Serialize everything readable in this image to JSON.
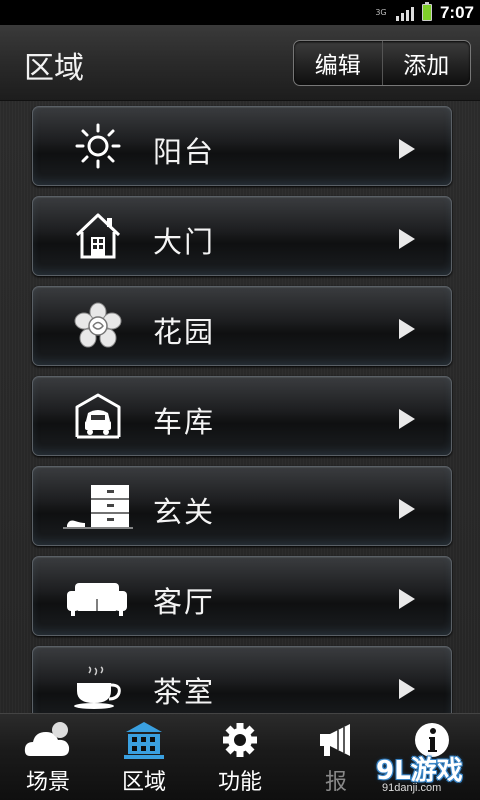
{
  "status_bar": {
    "network": "3G",
    "time": "7:07"
  },
  "header": {
    "title": "区域",
    "edit_label": "编辑",
    "add_label": "添加"
  },
  "areas": [
    {
      "label": "阳台",
      "icon": "sun-icon"
    },
    {
      "label": "大门",
      "icon": "house-icon"
    },
    {
      "label": "花园",
      "icon": "flower-icon"
    },
    {
      "label": "车库",
      "icon": "garage-icon"
    },
    {
      "label": "玄关",
      "icon": "cabinet-icon"
    },
    {
      "label": "客厅",
      "icon": "sofa-icon"
    },
    {
      "label": "茶室",
      "icon": "teacup-icon"
    }
  ],
  "bottom_nav": [
    {
      "label": "场景",
      "icon": "cloud-icon",
      "active": false
    },
    {
      "label": "区域",
      "icon": "building-icon",
      "active": true
    },
    {
      "label": "功能",
      "icon": "gear-icon",
      "active": false
    },
    {
      "label": "报",
      "icon": "megaphone-icon",
      "active": false
    },
    {
      "label": "",
      "icon": "info-icon",
      "active": false
    }
  ],
  "watermark": {
    "main": "9L游戏",
    "sub": "91danji.com"
  },
  "colors": {
    "active_nav": "#3aa0e0",
    "battery": "#7fcf2a"
  }
}
